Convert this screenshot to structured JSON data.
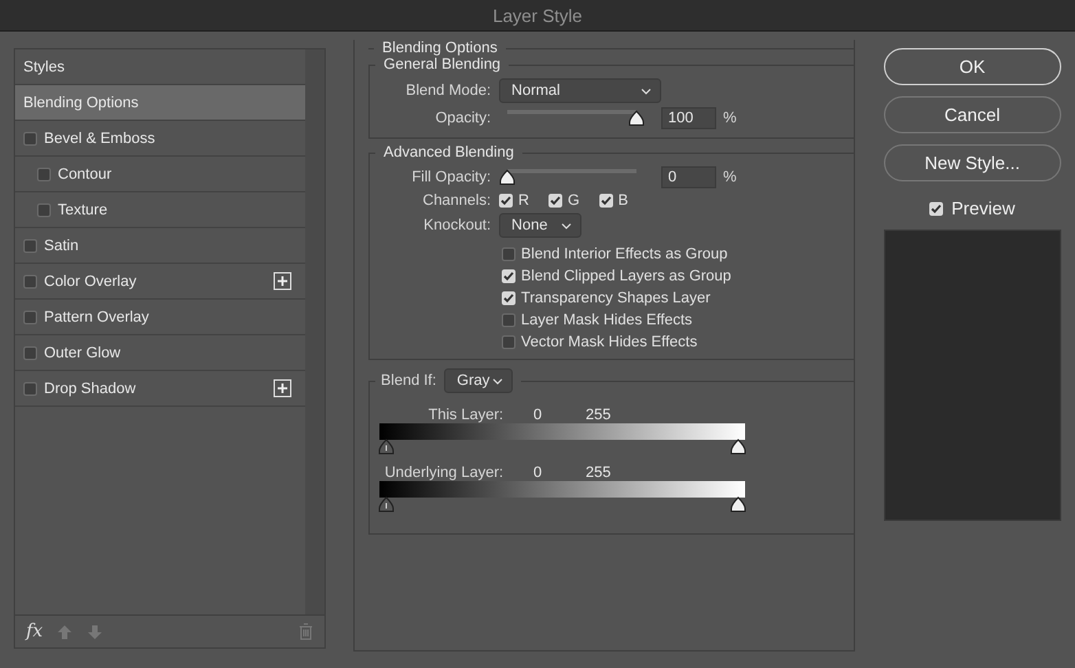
{
  "window": {
    "title": "Layer Style"
  },
  "styles_list": {
    "header": "Styles",
    "items": [
      {
        "label": "Blending Options",
        "kind": "plain",
        "selected": true
      },
      {
        "label": "Bevel & Emboss",
        "kind": "check",
        "checked": false,
        "selected": false,
        "children": [
          {
            "label": "Contour",
            "kind": "check",
            "checked": false,
            "selected": false
          },
          {
            "label": "Texture",
            "kind": "check",
            "checked": false,
            "selected": false
          }
        ]
      },
      {
        "label": "Satin",
        "kind": "check",
        "checked": false,
        "selected": false
      },
      {
        "label": "Color Overlay",
        "kind": "check",
        "checked": false,
        "selected": false,
        "addable": true
      },
      {
        "label": "Pattern Overlay",
        "kind": "check",
        "checked": false,
        "selected": false
      },
      {
        "label": "Outer Glow",
        "kind": "check",
        "checked": false,
        "selected": false
      },
      {
        "label": "Drop Shadow",
        "kind": "check",
        "checked": false,
        "selected": false,
        "addable": true
      }
    ],
    "footer": {
      "fx": "fx"
    }
  },
  "blending_options": {
    "title": "Blending Options",
    "general": {
      "title": "General Blending",
      "blend_mode": {
        "label": "Blend Mode:",
        "value": "Normal"
      },
      "opacity": {
        "label": "Opacity:",
        "level": 1,
        "value": "100",
        "unit": "%"
      }
    },
    "advanced": {
      "title": "Advanced Blending",
      "fill_opacity": {
        "label": "Fill Opacity:",
        "level": 0,
        "value": "0",
        "unit": "%"
      },
      "channels": {
        "label": "Channels:",
        "items": [
          {
            "label": "R",
            "checked": true
          },
          {
            "label": "G",
            "checked": true
          },
          {
            "label": "B",
            "checked": true
          }
        ]
      },
      "knockout": {
        "label": "Knockout:",
        "value": "None"
      },
      "options": [
        {
          "label": "Blend Interior Effects as Group",
          "checked": false
        },
        {
          "label": "Blend Clipped Layers as Group",
          "checked": true
        },
        {
          "label": "Transparency Shapes Layer",
          "checked": true
        },
        {
          "label": "Layer Mask Hides Effects",
          "checked": false
        },
        {
          "label": "Vector Mask Hides Effects",
          "checked": false
        }
      ]
    },
    "blend_if": {
      "label": "Blend If:",
      "value": "Gray",
      "rows": [
        {
          "label": "This Layer:",
          "low": "0",
          "high": "255",
          "thumbs": [
            {
              "level": 0
            },
            {
              "level": 1
            }
          ]
        },
        {
          "label": "Underlying Layer:",
          "low": "0",
          "high": "255",
          "thumbs": [
            {
              "level": 0
            },
            {
              "level": 1
            }
          ]
        }
      ]
    }
  },
  "buttons": [
    {
      "label": "OK",
      "kind": "default"
    },
    {
      "label": "Cancel",
      "kind": "normal"
    },
    {
      "label": "New Style...",
      "kind": "normal"
    }
  ],
  "preview": {
    "label": "Preview",
    "checked": true
  }
}
